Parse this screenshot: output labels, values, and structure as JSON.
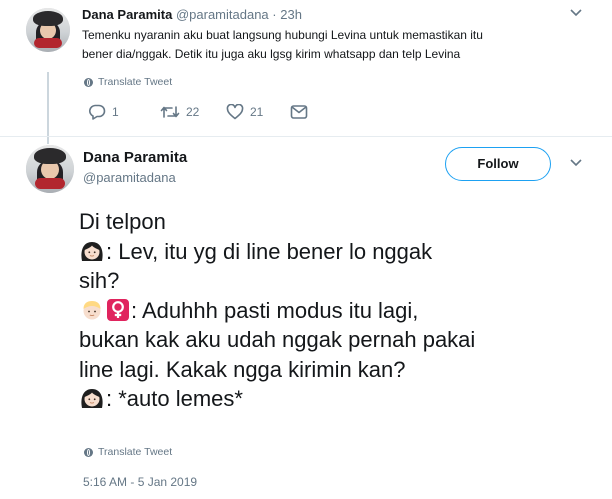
{
  "tweet1": {
    "name": "Dana Paramita",
    "handle": "@paramitadana",
    "separator": "·",
    "time": "23h",
    "text_line1": "Temenku nyaranin aku buat langsung hubungi Levina untuk memastikan itu",
    "text_line2": "bener dia/nggak. Detik itu juga aku lgsg kirim whatsapp dan telp Levina",
    "translate_label": "Translate Tweet",
    "reply_count": "1",
    "retweet_count": "22",
    "like_count": "21",
    "icons": [
      "chevron-down-icon",
      "globe-icon",
      "reply-icon",
      "retweet-icon",
      "like-icon",
      "message-icon"
    ]
  },
  "tweet2": {
    "name": "Dana Paramita",
    "handle": "@paramitadana",
    "follow_label": "Follow",
    "lines": [
      "Di telpon",
      ": Lev, itu yg di line bener lo nggak",
      "sih?",
      ": Aduhhh pasti modus itu lagi,",
      "bukan kak aku udah nggak pernah pakai",
      "line lagi. Kakak ngga kirimin kan?",
      ": *auto lemes*"
    ],
    "translate_label": "Translate Tweet",
    "timestamp": "5:16 AM - 5 Jan 2019",
    "icons": [
      "girl-emoji-icon",
      "blond-person-emoji-icon",
      "female-sign-emoji-icon",
      "chevron-down-icon",
      "globe-icon"
    ]
  },
  "colors": {
    "accent": "#1da1f2",
    "text": "#14171a",
    "muted": "#657786",
    "border": "#e6ecf0",
    "female_sign_bg": "#e0245e"
  }
}
